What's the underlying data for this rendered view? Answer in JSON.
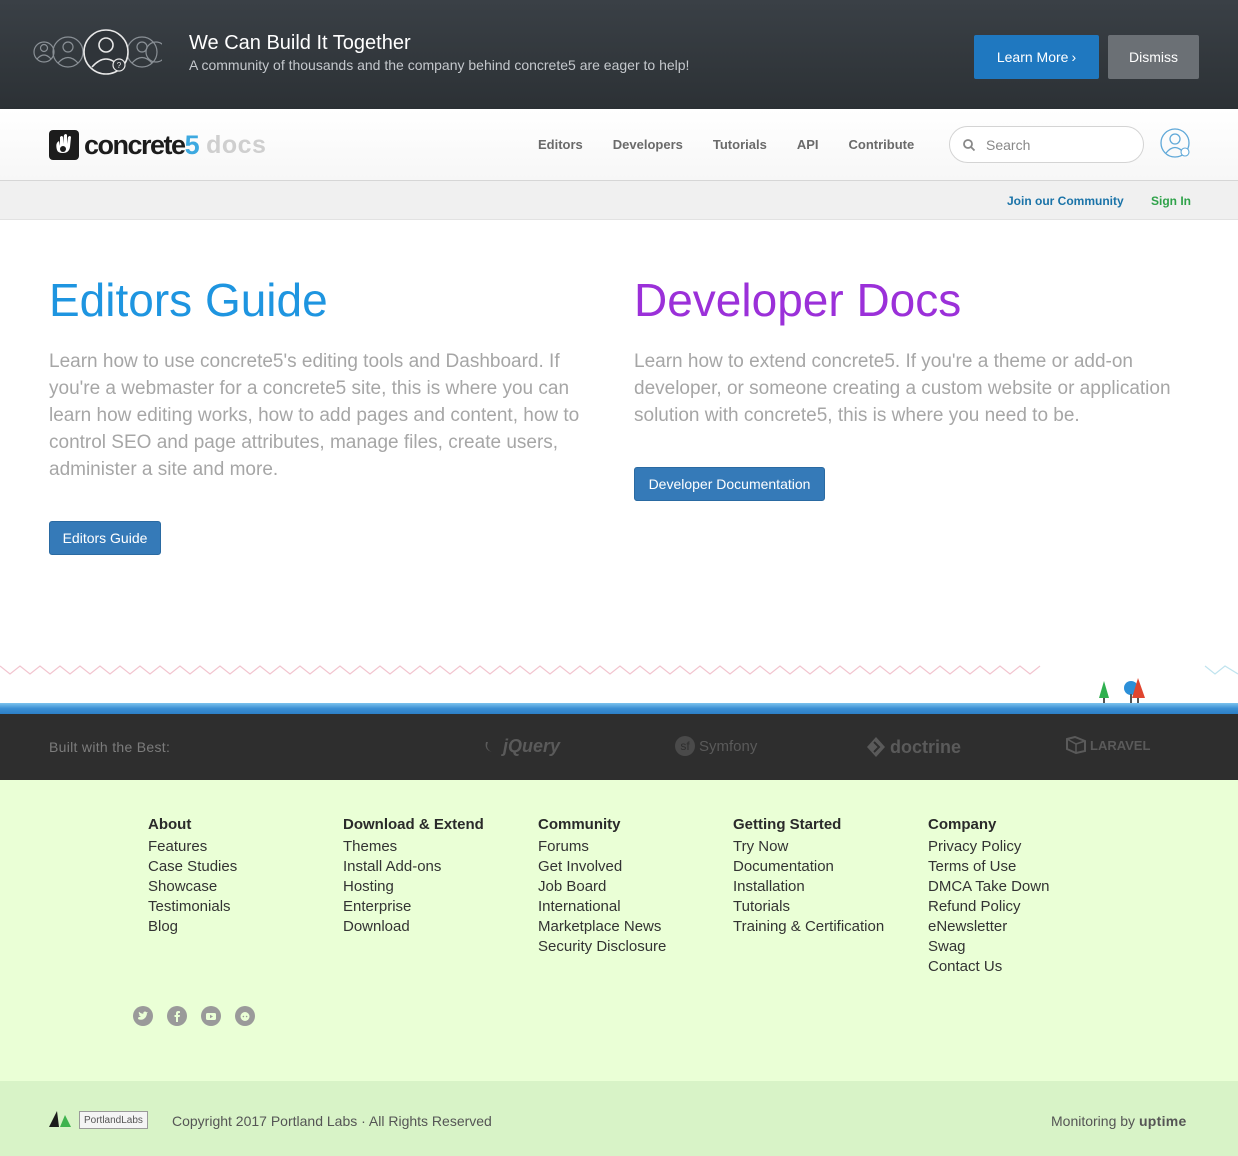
{
  "banner": {
    "title": "We Can Build It Together",
    "subtitle": "A community of thousands and the company behind concrete5 are eager to help!",
    "learn_more": "Learn More",
    "learn_more_glyph": "›",
    "dismiss": "Dismiss"
  },
  "header": {
    "logo_main": "concrete",
    "logo_five": "5",
    "logo_docs": "docs",
    "nav": [
      "Editors",
      "Developers",
      "Tutorials",
      "API",
      "Contribute"
    ],
    "search_placeholder": "Search"
  },
  "subbar": {
    "join": "Join our Community",
    "signin": "Sign In"
  },
  "main": {
    "editors": {
      "title": "Editors Guide",
      "description": "Learn how to use concrete5's editing tools and Dashboard. If you're a webmaster for a concrete5 site, this is where you can learn how editing works, how to add pages and content, how to control SEO and page attributes, manage files, create users, administer a site and more.",
      "button": "Editors Guide"
    },
    "developers": {
      "title": "Developer Docs",
      "description": "Learn how to extend concrete5. If you're a theme or add-on developer, or someone creating a custom website or application solution with concrete5, this is where you need to be.",
      "button": "Developer Documentation"
    }
  },
  "built_with": {
    "label": "Built with the Best:",
    "brands": [
      "jQuery",
      "Symfony",
      "doctrine",
      "LARAVEL"
    ]
  },
  "footer": {
    "columns": [
      {
        "heading": "About",
        "links": [
          "Features",
          "Case Studies",
          "Showcase",
          "Testimonials",
          "Blog"
        ]
      },
      {
        "heading": "Download & Extend",
        "links": [
          "Themes",
          "Install Add-ons",
          "Hosting",
          "Enterprise",
          "Download"
        ]
      },
      {
        "heading": "Community",
        "links": [
          "Forums",
          "Get Involved",
          "Job Board",
          "International",
          "Marketplace News",
          "Security Disclosure"
        ]
      },
      {
        "heading": "Getting Started",
        "links": [
          "Try Now",
          "Documentation",
          "Installation",
          "Tutorials",
          "Training & Certification"
        ]
      },
      {
        "heading": "Company",
        "links": [
          "Privacy Policy",
          "Terms of Use",
          "DMCA Take Down",
          "Refund Policy",
          "eNewsletter",
          "Swag",
          "Contact Us"
        ]
      }
    ],
    "social_icons": [
      "twitter-icon",
      "facebook-icon",
      "youtube-icon",
      "github-icon"
    ]
  },
  "bottom": {
    "badge": "PortlandLabs",
    "copyright": "Copyright 2017 Portland Labs  ·  All Rights Reserved",
    "monitoring": "Monitoring by",
    "uptime": "uptime"
  },
  "colors": {
    "editors_title": "#1e95e0",
    "developers_title": "#9b30d9",
    "primary_button": "#357ab8",
    "footer_bg": "#eaffd6"
  }
}
